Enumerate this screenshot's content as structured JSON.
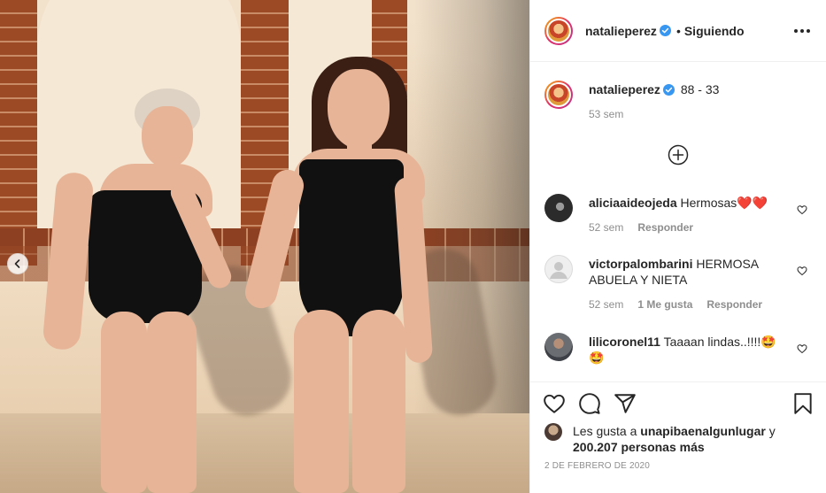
{
  "post": {
    "author": "natalieperez",
    "follow_separator": "•",
    "follow_status": "Siguiendo",
    "caption_text": "88 - 33",
    "caption_time": "53 sem",
    "date": "2 DE FEBRERO DE 2020"
  },
  "comments": [
    {
      "username": "aliciaaideojeda",
      "text": "Hermosas❤️❤️",
      "time": "52 sem",
      "reply": "Responder",
      "likes": ""
    },
    {
      "username": "victorpalombarini",
      "text": "HERMOSA ABUELA Y NIETA",
      "time": "52 sem",
      "likes": "1 Me gusta",
      "reply": "Responder"
    },
    {
      "username": "lilicoronel11",
      "text": "Taaaan lindas..!!!!🤩🤩"
    }
  ],
  "likes": {
    "prefix": "Les gusta a",
    "user": "unapibaenalgunlugar",
    "joiner": "y",
    "count": "200.207 personas más"
  },
  "icons": {
    "carousel": "chevron-left-icon",
    "verified": "verified-badge-icon",
    "more": "more-options-icon",
    "load_more": "plus-circle-icon",
    "like": "heart-icon",
    "comment": "comment-icon",
    "share": "share-icon",
    "save": "bookmark-icon"
  },
  "colors": {
    "verified": "#3897f0",
    "text": "#262626",
    "muted": "#8e8e8e",
    "border": "#efefef"
  }
}
